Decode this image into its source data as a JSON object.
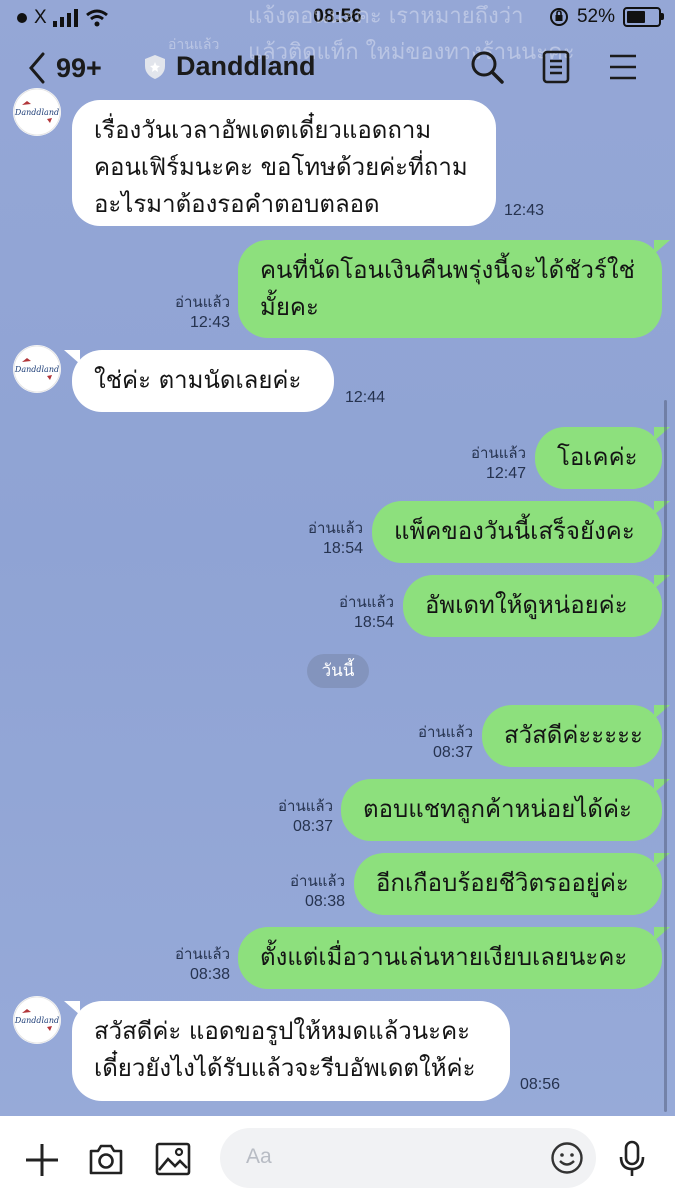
{
  "status_bar": {
    "carrier": "X",
    "time": "08:56",
    "battery": "52%",
    "battery_level": 0.52
  },
  "background_text": {
    "line1": "แจ้งตอนนะคะ เราหมายถึงว่า",
    "line2": "แล้วติดแท็ก ใหม่ของทางร้านนะคะ",
    "line3": "อ่านแล้ว"
  },
  "header": {
    "back_count": "99+",
    "chat_name": "Danddland",
    "icons": [
      "chevron-left-icon",
      "shield-icon",
      "search-icon",
      "notes-icon",
      "menu-icon"
    ]
  },
  "avatar_text": "Danddland",
  "messages": [
    {
      "dir": "in",
      "lines": [
        "เรื่องวันเวลาอัพเดตเดี๋ยวแอดถาม",
        "คอนเฟิร์มนะคะ ขอโทษด้วยค่ะที่ถาม",
        "อะไรมาต้องรอคำตอบตลอด"
      ],
      "time": "12:43"
    },
    {
      "dir": "out",
      "lines": [
        "คนที่นัดโอนเงินคืนพรุ่งนี้จะได้ชัวร์ใช่",
        "มั้ยคะ"
      ],
      "read": "อ่านแล้ว",
      "time": "12:43"
    },
    {
      "dir": "in",
      "lines": [
        "ใช่ค่ะ ตามนัดเลยค่ะ"
      ],
      "time": "12:44"
    },
    {
      "dir": "out",
      "lines": [
        "โอเคค่ะ"
      ],
      "read": "อ่านแล้ว",
      "time": "12:47"
    },
    {
      "dir": "out",
      "lines": [
        "แพ็คของวันนี้เสร็จยังคะ"
      ],
      "read": "อ่านแล้ว",
      "time": "18:54"
    },
    {
      "dir": "out",
      "lines": [
        "อัพเดทให้ดูหน่อยค่ะ"
      ],
      "read": "อ่านแล้ว",
      "time": "18:54"
    },
    {
      "dir": "out",
      "lines": [
        "สวัสดีค่ะะะะะ"
      ],
      "read": "อ่านแล้ว",
      "time": "08:37"
    },
    {
      "dir": "out",
      "lines": [
        "ตอบแชทลูกค้าหน่อยได้ค่ะ"
      ],
      "read": "อ่านแล้ว",
      "time": "08:37"
    },
    {
      "dir": "out",
      "lines": [
        "อีกเกือบร้อยชีวิตรออยู่ค่ะ"
      ],
      "read": "อ่านแล้ว",
      "time": "08:38"
    },
    {
      "dir": "out",
      "lines": [
        "ตั้งแต่เมื่อวานเล่นหายเงียบเลยนะคะ"
      ],
      "read": "อ่านแล้ว",
      "time": "08:38"
    },
    {
      "dir": "in",
      "lines": [
        "สวัสดีค่ะ แอดขอรูปให้หมดแล้วนะคะ",
        "เดี๋ยวยังไงได้รับแล้วจะรีบอัพเดตให้ค่ะ"
      ],
      "time": "08:56"
    }
  ],
  "date_separator": "วันนี้",
  "input": {
    "placeholder": "Aa"
  },
  "colors": {
    "outgoing_bubble": "#8de07d",
    "incoming_bubble": "#ffffff",
    "background": "#95a7d6"
  }
}
